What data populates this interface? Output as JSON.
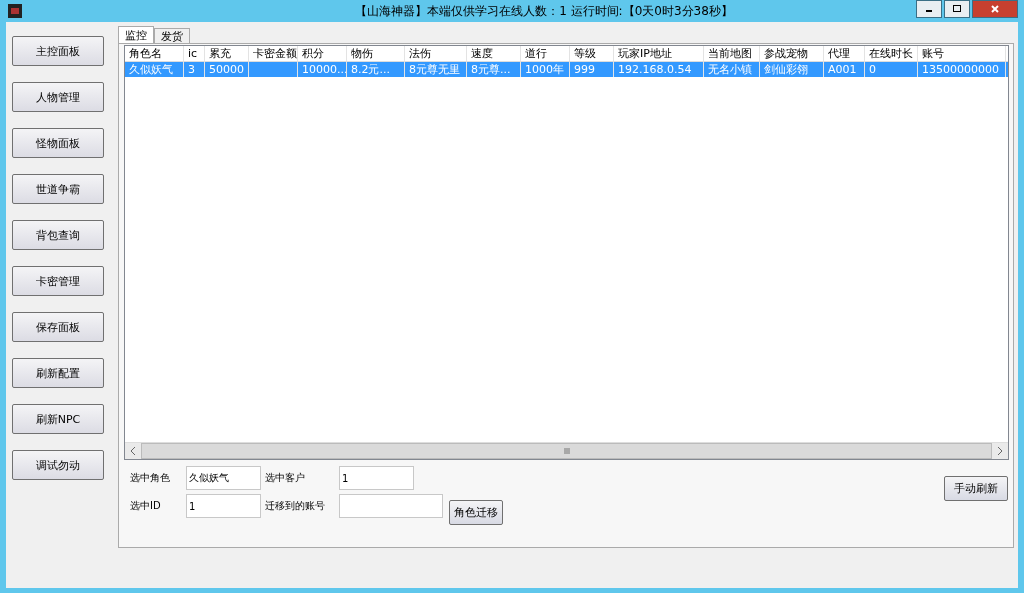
{
  "window": {
    "title": "【山海神器】本端仅供学习在线人数：1  运行时间:【0天0时3分38秒】"
  },
  "sidebar": {
    "buttons": [
      "主控面板",
      "人物管理",
      "怪物面板",
      "世道争霸",
      "背包查询",
      "卡密管理",
      "保存面板",
      "刷新配置",
      "刷新NPC",
      "调试勿动"
    ]
  },
  "tabs": [
    {
      "label": "监控",
      "selected": true
    },
    {
      "label": "发货",
      "selected": false
    }
  ],
  "table": {
    "columns": [
      "角色名",
      "ic",
      "累充",
      "卡密金额",
      "积分",
      "物伤",
      "法伤",
      "速度",
      "道行",
      "等级",
      "玩家IP地址",
      "当前地图",
      "参战宠物",
      "代理",
      "在线时长",
      "账号"
    ],
    "rows": [
      {
        "selected": true,
        "cells": [
          "久似妖气",
          "3",
          "50000",
          "",
          "10000...",
          "8.2元...",
          "8元尊无里",
          "8元尊...",
          "1000年",
          "999",
          "192.168.0.54",
          "无名小镇",
          "剑仙彩翎",
          "A001",
          "0",
          "13500000000"
        ]
      }
    ]
  },
  "form": {
    "fields": [
      {
        "label": "选中角色",
        "value": "久似妖气"
      },
      {
        "label": "选中客户",
        "value": "1"
      },
      {
        "label": "选中ID",
        "value": "1"
      },
      {
        "label": "迁移到的账号"
      }
    ],
    "migrate_button": "角色迁移",
    "refresh_button": "手动刷新"
  }
}
